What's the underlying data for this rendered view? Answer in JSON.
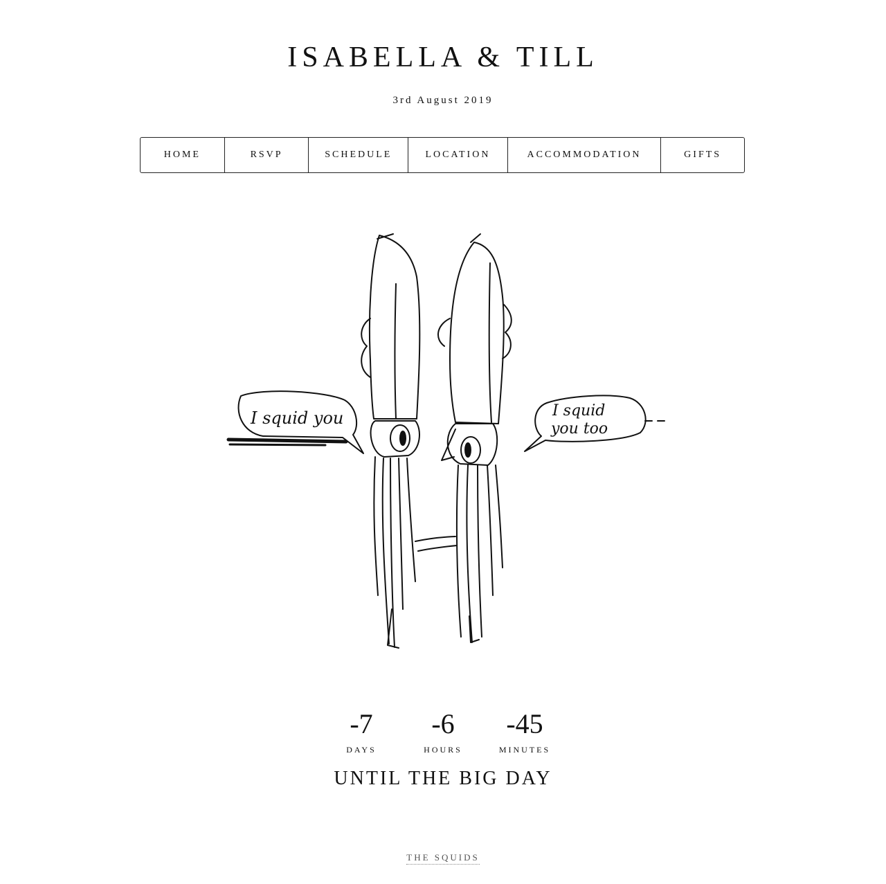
{
  "header": {
    "title": "ISABELLA & TILL",
    "date": "3rd August 2019"
  },
  "nav": {
    "items": [
      {
        "label": "HOME"
      },
      {
        "label": "RSVP"
      },
      {
        "label": "SCHEDULE"
      },
      {
        "label": "LOCATION"
      },
      {
        "label": "ACCOMMODATION"
      },
      {
        "label": "GIFTS"
      }
    ]
  },
  "illustration": {
    "bubble_left": "I squid you",
    "bubble_right_line1": "I squid",
    "bubble_right_line2": "you too"
  },
  "countdown": {
    "days": {
      "value": "-7",
      "label": "DAYS"
    },
    "hours": {
      "value": "-6",
      "label": "HOURS"
    },
    "minutes": {
      "value": "-45",
      "label": "MINUTES"
    },
    "tagline": "UNTIL THE BIG DAY"
  },
  "footer": {
    "link": "THE SQUIDS"
  }
}
